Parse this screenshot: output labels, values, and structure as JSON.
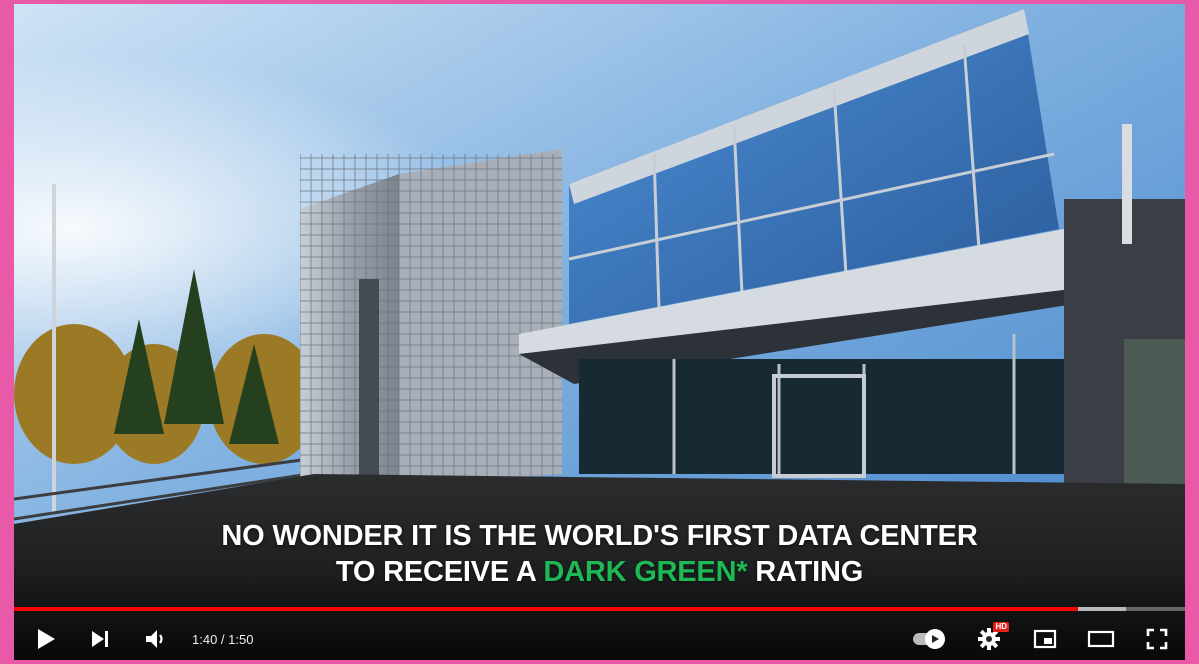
{
  "video": {
    "caption_line1": "NO WONDER IT IS THE WORLD'S FIRST DATA CENTER",
    "caption_line2_before": "TO RECEIVE A ",
    "caption_highlight": "DARK GREEN*",
    "caption_line2_after": " RATING",
    "highlight_color": "#1db954"
  },
  "player": {
    "current_time": "1:40",
    "separator": " / ",
    "duration": "1:50",
    "progress_played_fraction": 0.909,
    "progress_loaded_fraction": 0.95,
    "progress_color": "#ff0000",
    "settings_badge": "HD",
    "icons": {
      "play": "play-icon",
      "next": "next-icon",
      "volume": "volume-icon",
      "autoplay": "autoplay-toggle-icon",
      "settings": "gear-icon",
      "miniplayer": "miniplayer-icon",
      "theater": "theater-mode-icon",
      "fullscreen": "fullscreen-icon"
    }
  }
}
